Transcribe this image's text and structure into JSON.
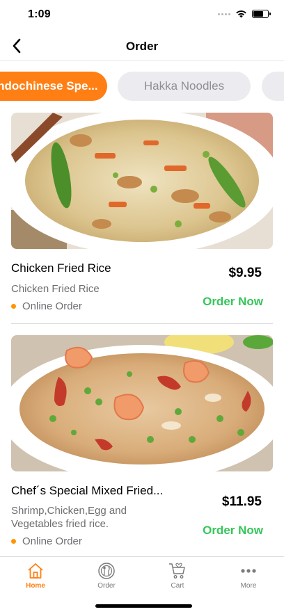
{
  "status_bar": {
    "time": "1:09"
  },
  "header": {
    "title": "Order",
    "back_icon": "chevron-left-icon"
  },
  "categories": [
    {
      "label": "Indochinese Spe...",
      "active": true
    },
    {
      "label": "Hakka Noodles",
      "active": false
    },
    {
      "label": "",
      "active": false
    }
  ],
  "menu_items": [
    {
      "name": "Chicken Fried Rice",
      "description": "Chicken Fried Rice",
      "type": "Online Order",
      "price": "$9.95",
      "action": "Order Now"
    },
    {
      "name": "Chef´s Special Mixed Fried...",
      "description": "Shrimp,Chicken,Egg and Vegetables fried rice.",
      "type": "Online Order",
      "price": "$11.95",
      "action": "Order Now"
    }
  ],
  "tab_bar": {
    "items": [
      {
        "label": "Home",
        "icon": "home-icon",
        "active": true
      },
      {
        "label": "Order",
        "icon": "plate-cutlery-icon",
        "active": false
      },
      {
        "label": "Cart",
        "icon": "cart-icon",
        "active": false
      },
      {
        "label": "More",
        "icon": "more-dots-icon",
        "active": false
      }
    ]
  },
  "colors": {
    "accent": "#ff7f14",
    "order_green": "#34c759",
    "dot": "#ff9500"
  }
}
